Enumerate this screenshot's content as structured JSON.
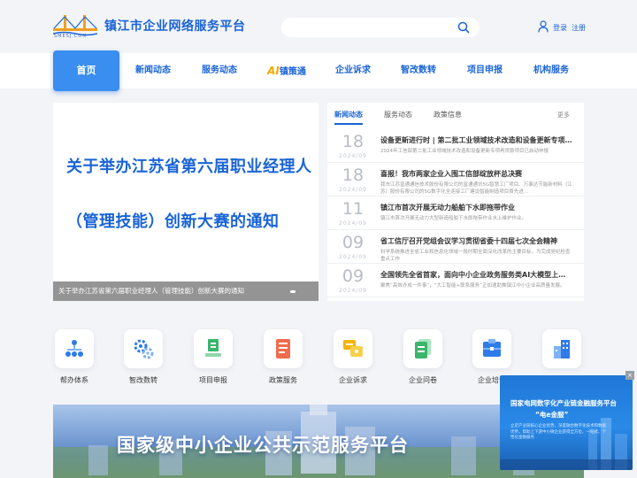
{
  "header": {
    "logo_text": "SMESJ.COM",
    "site_title": "镇江市企业网络服务平台",
    "search_placeholder": "",
    "login": "登录",
    "register": "注册"
  },
  "nav": {
    "home": "首页",
    "items": [
      "新闻动态",
      "服务动态",
      "镇策通",
      "企业诉求",
      "智改数转",
      "项目申报",
      "机构服务"
    ],
    "ai_prefix": "AI"
  },
  "banner": {
    "line1": "关于举办江苏省第六届职业经理人",
    "line2": "（管理技能）创新大赛的通知",
    "caption": "关于举办江苏省第六届职业经理人（管理技能）创新大赛的通知"
  },
  "news": {
    "tabs": [
      "新闻动态",
      "服务动态",
      "政策信息"
    ],
    "more": "更多",
    "items": [
      {
        "day": "18",
        "month": "2024/09",
        "title": "设备更新进行时 | 第二批工业领域技术改造和设备更新专项…",
        "desc": "2024年工信部第二批工业领域技术改造和设备更新专项再贷款项目已启动申报"
      },
      {
        "day": "18",
        "month": "2024/09",
        "title": "喜报！我市两家企业入围工信部绽放杯总决赛",
        "desc": "我市江苏富通通信技术股份有限公司的富通通讯5G智慧工厂项目、万事达节能新材料（江苏）股份有限公司的5G数字化全连接工厂建设智能制造项目首先进…"
      },
      {
        "day": "11",
        "month": "2024/09",
        "title": "镇江市首次开展无动力船舶下水即拖带作业",
        "desc": "镇江市首次开展无动力大型新造船舶下水即拖带作业水上维护作业。"
      },
      {
        "day": "09",
        "month": "2024/09",
        "title": "省工信厅召开党组会议学习贯彻省委十四届七次全会精神",
        "desc": "科学系统推进全省工业和信息化领域一段时期全面深化改革的主要目标，为完成党纪检查重点工作"
      },
      {
        "day": "09",
        "month": "2024/09",
        "title": "全国领先全省首家，面向中小企业政务服务类AI大模型上…",
        "desc": "聚焦“高效办成一件事”，“大工智能+联系服务”正加速助推镇江中小企业高质量发展。"
      }
    ]
  },
  "services": [
    {
      "label": "帮办体系",
      "icon": "org-chart-icon"
    },
    {
      "label": "智改数转",
      "icon": "gears-icon"
    },
    {
      "label": "项目申报",
      "icon": "stamp-icon"
    },
    {
      "label": "政策服务",
      "icon": "policy-doc-icon"
    },
    {
      "label": "企业诉求",
      "icon": "feedback-icon"
    },
    {
      "label": "企业问卷",
      "icon": "questionnaire-icon"
    },
    {
      "label": "企业培训",
      "icon": "training-icon"
    },
    {
      "label": "",
      "icon": "building-icon"
    }
  ],
  "bottom_banner": {
    "title": "国家级中小企业公共示范服务平台"
  },
  "ad": {
    "close": "×",
    "title": "国家电网数字化产业链金融服务平台",
    "subtitle": "“电e金服”",
    "desc": "立足产业链核心企业优势，深度融合数字化技术和数据优势，帮助上下游中小微企业获得全方位、一站式、个性化金融服务"
  },
  "colors": {
    "brand_blue": "#1a64d6",
    "nav_home_bg": "#3a8ef0",
    "ai_orange": "#f5a800"
  }
}
